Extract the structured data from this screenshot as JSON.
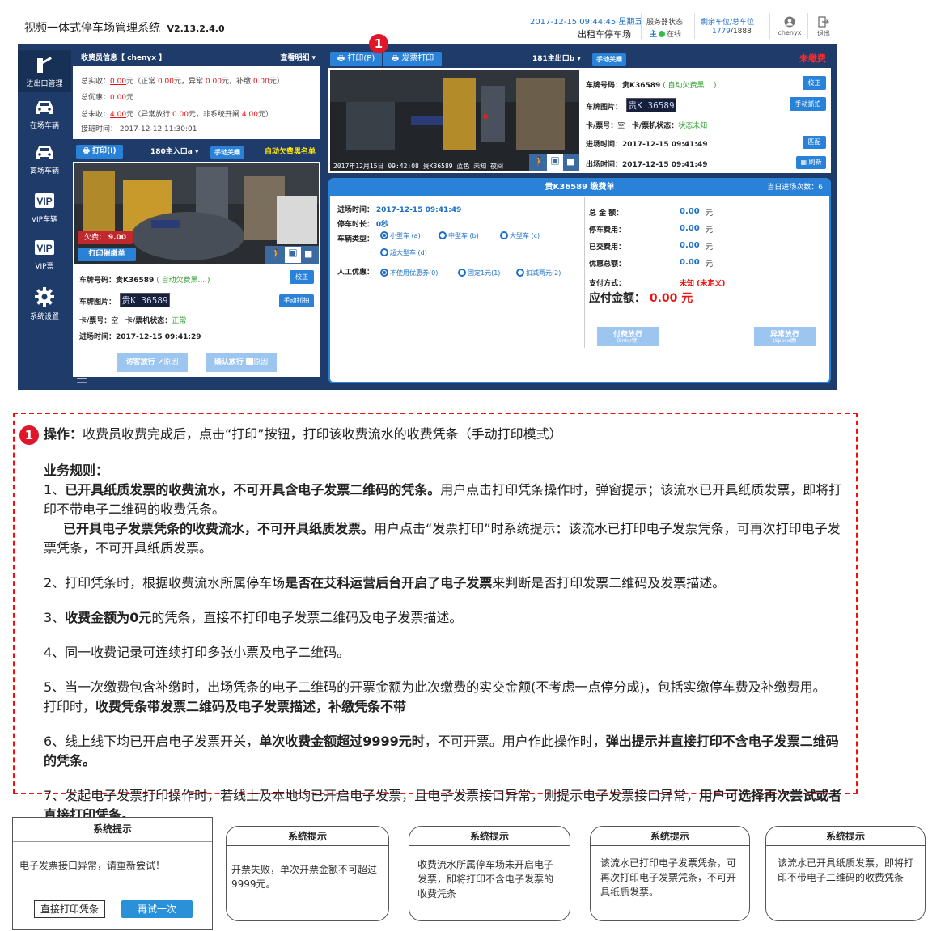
{
  "header": {
    "app_title": "视频一体式停车场管理系统",
    "version": "V2.13.2.4.0",
    "datetime": "2017-12-15 09:44:45",
    "weekday": "星期五",
    "lot_name": "出租车停车场",
    "server_label": "服务器状态",
    "server_main": "主",
    "server_status": "在线",
    "spaces_label": "剩余车位/总车位",
    "spaces_free": "1779",
    "spaces_total": "/1888",
    "user": "chenyx",
    "exit_label": "退出"
  },
  "sidebar": {
    "items": [
      {
        "label": "进出口管理",
        "icon": "gate-icon"
      },
      {
        "label": "在场车辆",
        "icon": "car-icon"
      },
      {
        "label": "离场车辆",
        "icon": "car-leave-icon"
      },
      {
        "label": "VIP车辆",
        "icon": "vip-car-icon"
      },
      {
        "label": "VIP票",
        "icon": "vip-ticket-icon"
      },
      {
        "label": "系统设置",
        "icon": "gear-icon"
      }
    ]
  },
  "collector": {
    "title": "收费员信息【 chenyx 】",
    "detail_link": "查看明细",
    "l1_label": "总实收：",
    "l1_val": "0.00",
    "l1_rest": "元（正常",
    "l1_b": "0.00",
    "l1_c": "元，异常",
    "l1_d": "0.00",
    "l1_e": "元，补缴",
    "l1_f": "0.00",
    "l1_g": "元）",
    "l2_label": "总优惠：",
    "l2_val": "0.00",
    "l2_unit": "元",
    "l3_label": "总未收：",
    "l3_val": "4.00",
    "l3_a": "元（异常放行",
    "l3_b": "0.00",
    "l3_c": "元，非系统开闸",
    "l3_d": "4.00",
    "l3_e": "元）",
    "l4": "接班时间： 2017-12-12 11:30:01"
  },
  "entrance": {
    "print_btn": "打印(I)",
    "gate_name": "180主入口a",
    "manual_close": "手动关闸",
    "auto_list": "自动欠费黑名单",
    "owed_label": "欠费：",
    "owed_val": "9.00",
    "print_notice": "打印催缴单",
    "plate_label": "车牌号码：",
    "plate_val": "贵K36589",
    "plate_tag": "( 自动欠费黑... )",
    "correct_btn": "校正",
    "plate_img_label": "车牌图片：",
    "plate_img_text": "贵K 36589",
    "manual_capture": "手动抓拍",
    "card_label": "卡/票号：",
    "card_val": "空",
    "card_status_label": "卡/票机状态：",
    "card_status_val": "正常",
    "entry_label": "进场时间：",
    "entry_val": "2017-12-15 09:41:29",
    "visitor_release": "访客放行",
    "reason1": "原因",
    "confirm_release": "确认放行",
    "reason2": "原因"
  },
  "exit": {
    "print_btn": "打印(P)",
    "invoice_btn": "发票打印",
    "gate_name": "181主出口b",
    "manual_close": "手动关闸",
    "unpaid": "未缴费",
    "cam_caption": "2017年12月15日 09:42:08 贵K36589 蓝色 未知 夜间",
    "plate_label": "车牌号码：",
    "plate_val": "贵K36589",
    "plate_tag": "( 自动欠费黑... )",
    "correct_btn": "校正",
    "plate_img_label": "车牌图片：",
    "plate_img_text": "贵K 36589",
    "manual_capture": "手动抓拍",
    "card_label": "卡/票号：",
    "card_val": "空",
    "card_status_label": "卡/票机状态：",
    "card_status_val": "状态未知",
    "entry_label": "进场时间：",
    "entry_val": "2017-12-15 09:41:49",
    "match_btn": "匹配",
    "exit_label": "出场时间：",
    "exit_val": "2017-12-15 09:41:49",
    "refresh_btn": "刷新"
  },
  "bill": {
    "title": "贵K36589 缴费单",
    "today_label": "当日进场次数：",
    "today_val": "6",
    "entry_label": "进场时间：",
    "entry_val": "2017-12-15 09:41:49",
    "stay_label": "停车时长：",
    "stay_val": "0秒",
    "type_label": "车辆类型：",
    "types": [
      "小型车 (a)",
      "中型车 (b)",
      "大型车 (c)",
      "超大型车 (d)"
    ],
    "discount_label": "人工优惠：",
    "discounts": [
      "不使用优惠券(0)",
      "固定1元(1)",
      "扣减两元(2)"
    ],
    "total_label": "总 金 额：",
    "total_val": "0.00",
    "fee_label": "停车费用：",
    "fee_val": "0.00",
    "paid_label": "已交费用：",
    "paid_val": "0.00",
    "disc_label": "优惠总额：",
    "disc_val": "0.00",
    "unit": "元",
    "pay_method_label": "支付方式：",
    "pay_method_val": "未知 (未定义)",
    "due_label": "应付金额：",
    "due_val": "0.00",
    "due_unit": "元",
    "pay_release": "付费放行",
    "pay_release_sub": "(Enter键)",
    "abnormal_release": "异常放行",
    "abnormal_release_sub": "(Space键)"
  },
  "marker": "1",
  "notes": {
    "op_label": "操作：",
    "op_text": "收费员收费完成后，点击“打印”按钮，打印该收费流水的收费凭条（手动打印模式）",
    "rules_title": "业务规则：",
    "r1_a": "1、",
    "r1_b": "已开具纸质发票的收费流水，不可开具含电子发票二维码的凭条。",
    "r1_c": "用户点击打印凭条操作时，弹窗提示；该流水已开具纸质发票，即将打印不带电子二维码的收费凭条。",
    "r1_d": "已开具电子发票凭条的收费流水，不可开具纸质发票。",
    "r1_e": "用户点击“发票打印”时系统提示：该流水已打印电子发票凭条，可再次打印电子发票凭条，不可开具纸质发票。",
    "r2_a": "2、打印凭条时，根据收费流水所属停车场",
    "r2_b": "是否在艾科运营后台开启了电子发票",
    "r2_c": "来判断是否打印发票二维码及发票描述。",
    "r3_a": "3、",
    "r3_b": "收费金额为0元",
    "r3_c": "的凭条，直接不打印电子发票二维码及电子发票描述。",
    "r4": "4、同一收费记录可连续打印多张小票及电子二维码。",
    "r5_a": "5、当一次缴费包含补缴时，出场凭条的电子二维码的开票金额为此次缴费的实交金额(不考虑一点停分成)，包括实缴停车费及补缴费用。",
    "r5_b": "打印时，",
    "r5_c": "收费凭条带发票二维码及电子发票描述，补缴凭条不带",
    "r6_a": "6、线上线下均已开启电子发票开关，",
    "r6_b": "单次收费金额超过9999元时",
    "r6_c": "，不可开票。用户作此操作时，",
    "r6_d": "弹出提示并直接打印不含电子发票二维码的凭条。",
    "r7_a": "7、发起电子发票打印操作时，若线上及本地均已开启电子发票，且电子发票接口异常，则提示电子发票接口异常，",
    "r7_b": "用户可选择再次尝试或者直接打印凭条。"
  },
  "dialogs": [
    {
      "title": "系统提示",
      "text": "电子发票接口异常，请重新尝试！",
      "btn1": "直接打印凭条",
      "btn2": "再试一次"
    },
    {
      "title": "系统提示",
      "text": "开票失败，单次开票金额不可超过9999元。"
    },
    {
      "title": "系统提示",
      "text": "收费流水所属停车场未开启电子发票，即将打印不含电子发票的收费凭条"
    },
    {
      "title": "系统提示",
      "text": "该流水已打印电子发票凭条，可再次打印电子发票凭条，不可开具纸质发票。"
    },
    {
      "title": "系统提示",
      "text": "该流水已开具纸质发票，即将打印不带电子二维码的收费凭条"
    }
  ]
}
